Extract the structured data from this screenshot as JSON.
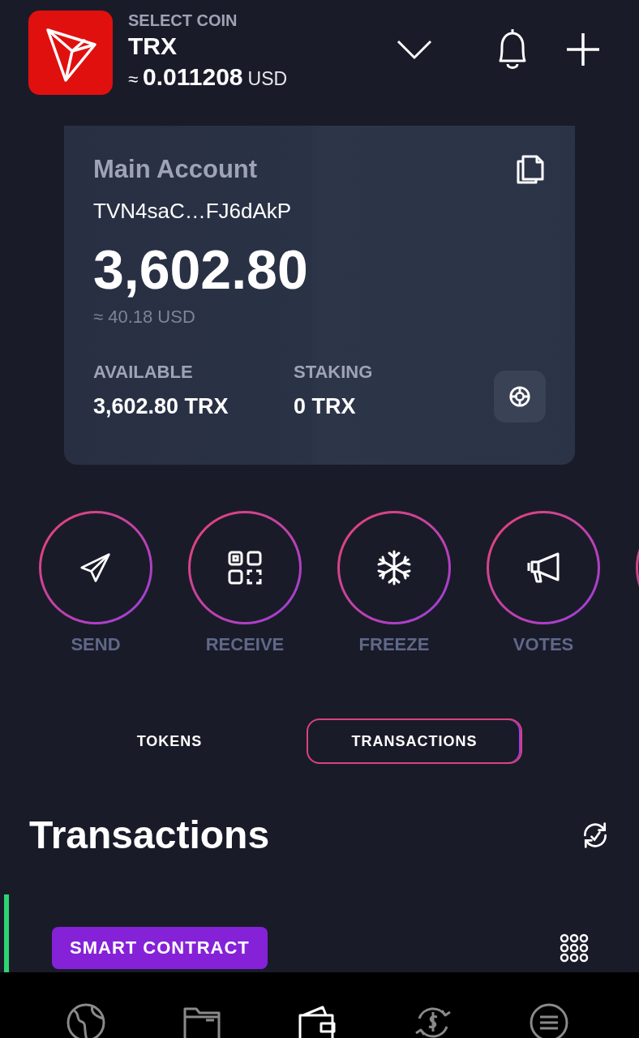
{
  "header": {
    "caption": "SELECT COIN",
    "coin": "TRX",
    "approx": "≈",
    "price": "0.011208",
    "currency": "USD"
  },
  "account": {
    "name": "Main Account",
    "address": "TVN4saC…FJ6dAkP",
    "balance": "3,602.80",
    "fiat": "≈ 40.18 USD",
    "stats": [
      {
        "label": "AVAILABLE",
        "value": "3,602.80 TRX"
      },
      {
        "label": "STAKING",
        "value": "0 TRX"
      }
    ]
  },
  "actions": [
    {
      "kind": "send",
      "label": "SEND"
    },
    {
      "kind": "receive",
      "label": "RECEIVE"
    },
    {
      "kind": "freeze",
      "label": "FREEZE"
    },
    {
      "kind": "votes",
      "label": "VOTES"
    },
    {
      "kind": "more"
    }
  ],
  "tabs": [
    {
      "label": "TOKENS",
      "selected": false
    },
    {
      "label": "TRANSACTIONS",
      "selected": true
    }
  ],
  "section_title": "Transactions",
  "transactions": [
    {
      "type": "SMART CONTRACT",
      "color": "#2ed573"
    }
  ],
  "nav": [
    {
      "kind": "globe",
      "selected": false
    },
    {
      "kind": "folder",
      "selected": false
    },
    {
      "kind": "wallet",
      "selected": true
    },
    {
      "kind": "exchange",
      "selected": false
    },
    {
      "kind": "menu",
      "selected": false
    }
  ]
}
